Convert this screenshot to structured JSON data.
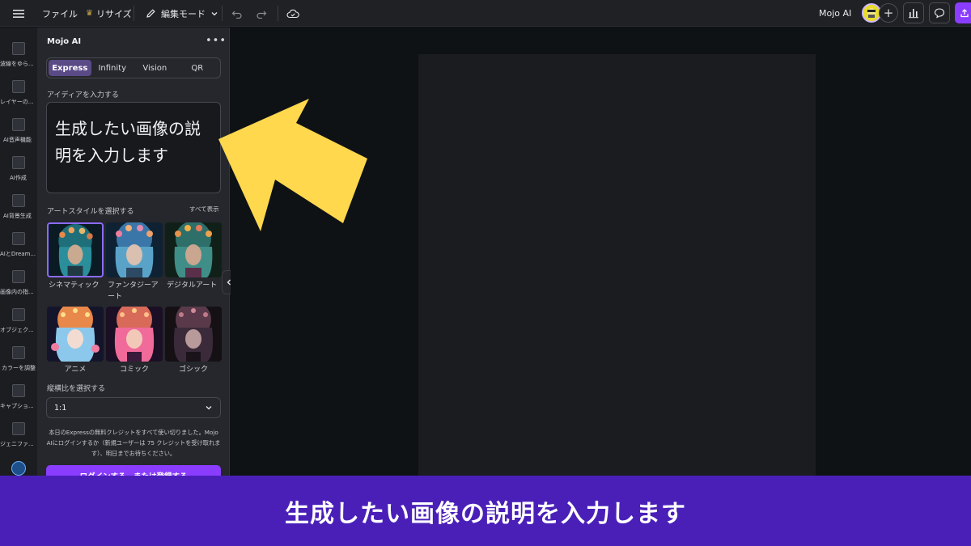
{
  "topbar": {
    "menu_icon": "hamburger-icon",
    "file": "ファイル",
    "resize": "リサイズ",
    "edit_mode": "編集モード",
    "app_name": "Mojo AI",
    "share_color": "#8b3dff"
  },
  "rail": {
    "items": [
      {
        "label": "波線をゆら..."
      },
      {
        "label": "レイヤーの..."
      },
      {
        "label": "AI音声機能"
      },
      {
        "label": "AI作成"
      },
      {
        "label": "AI背景生成"
      },
      {
        "label": "AIとDream..."
      },
      {
        "label": "画像内の指..."
      },
      {
        "label": "オブジェク..."
      },
      {
        "label": "カラーを調整"
      },
      {
        "label": "キャプショ..."
      },
      {
        "label": "ジェニファ..."
      }
    ]
  },
  "panel": {
    "title": "Mojo AI",
    "tabs": [
      {
        "label": "Express"
      },
      {
        "label": "Infinity"
      },
      {
        "label": "Vision"
      },
      {
        "label": "QR"
      }
    ],
    "idea_label": "アイディアを入力する",
    "prompt_text": "生成したい画像の説明を入力します",
    "style_label": "アートスタイルを選択する",
    "see_all": "すべて表示",
    "styles": [
      {
        "label": "シネマティック"
      },
      {
        "label": "ファンタジーアート"
      },
      {
        "label": "デジタルアート"
      },
      {
        "label": "アニメ"
      },
      {
        "label": "コミック"
      },
      {
        "label": "ゴシック"
      }
    ],
    "aspect_label": "縦横比を選択する",
    "aspect_value": "1:1",
    "notice": "本日のExpressの無料クレジットをすべて使い切りました。Mojo AIにログインするか（新規ユーザーは 75 クレジットを受け取れます）、明日までお待ちください。",
    "login_button": "ログインする、または登録する"
  },
  "caption": {
    "text": "生成したい画像の説明を入力します",
    "color": "#4a1fb8"
  },
  "arrow": {
    "color": "#ffd84d"
  }
}
